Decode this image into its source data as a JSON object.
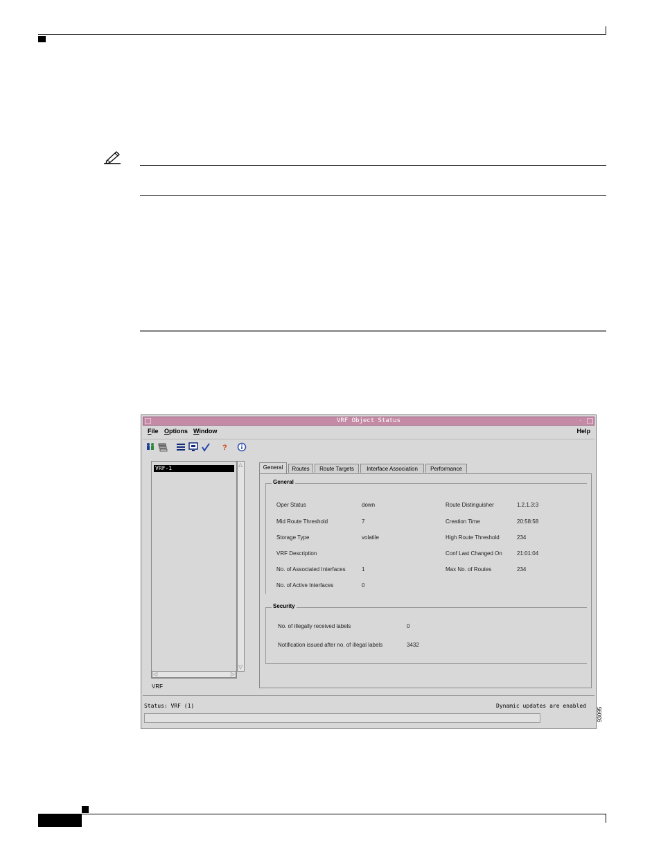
{
  "figure_id": "93095",
  "window": {
    "title": "VRF Object Status",
    "menus": [
      {
        "label": "File",
        "underline": "F",
        "rest": "ile"
      },
      {
        "label": "Options",
        "underline": "O",
        "rest": "ptions"
      },
      {
        "label": "Window",
        "underline": "W",
        "rest": "indow"
      }
    ],
    "help_label": "Help",
    "tree": {
      "selected_item": "VRF-1",
      "caption": "VRF"
    },
    "tabs": [
      "General",
      "Routes",
      "Route Targets",
      "Interface Association",
      "Performance"
    ],
    "active_tab": "General",
    "general": {
      "group_label": "General",
      "left_fields": [
        {
          "label": "Oper Status",
          "value": "down"
        },
        {
          "label": "Mid Route Threshold",
          "value": "7"
        },
        {
          "label": "Storage Type",
          "value": "volatile"
        },
        {
          "label": "VRF Description",
          "value": ""
        },
        {
          "label": "No. of Associated Interfaces",
          "value": "1"
        },
        {
          "label": "No. of Active Interfaces",
          "value": "0"
        }
      ],
      "right_fields": [
        {
          "label": "Route Distinguisher",
          "value": "1.2.1.3:3"
        },
        {
          "label": "Creation Time",
          "value": "20:58:58"
        },
        {
          "label": "High Route Threshold",
          "value": "234"
        },
        {
          "label": "Conf Last Changed On",
          "value": "21:01:04"
        },
        {
          "label": "Max No. of Routes",
          "value": "234"
        }
      ]
    },
    "security": {
      "group_label": "Security",
      "fields": [
        {
          "label": "No. of illegally received labels",
          "value": "0"
        },
        {
          "label": "Notification issued after no. of illegal labels",
          "value": "3432"
        }
      ]
    },
    "status_left": "Status: VRF (1)",
    "status_right": "Dynamic updates are enabled"
  }
}
